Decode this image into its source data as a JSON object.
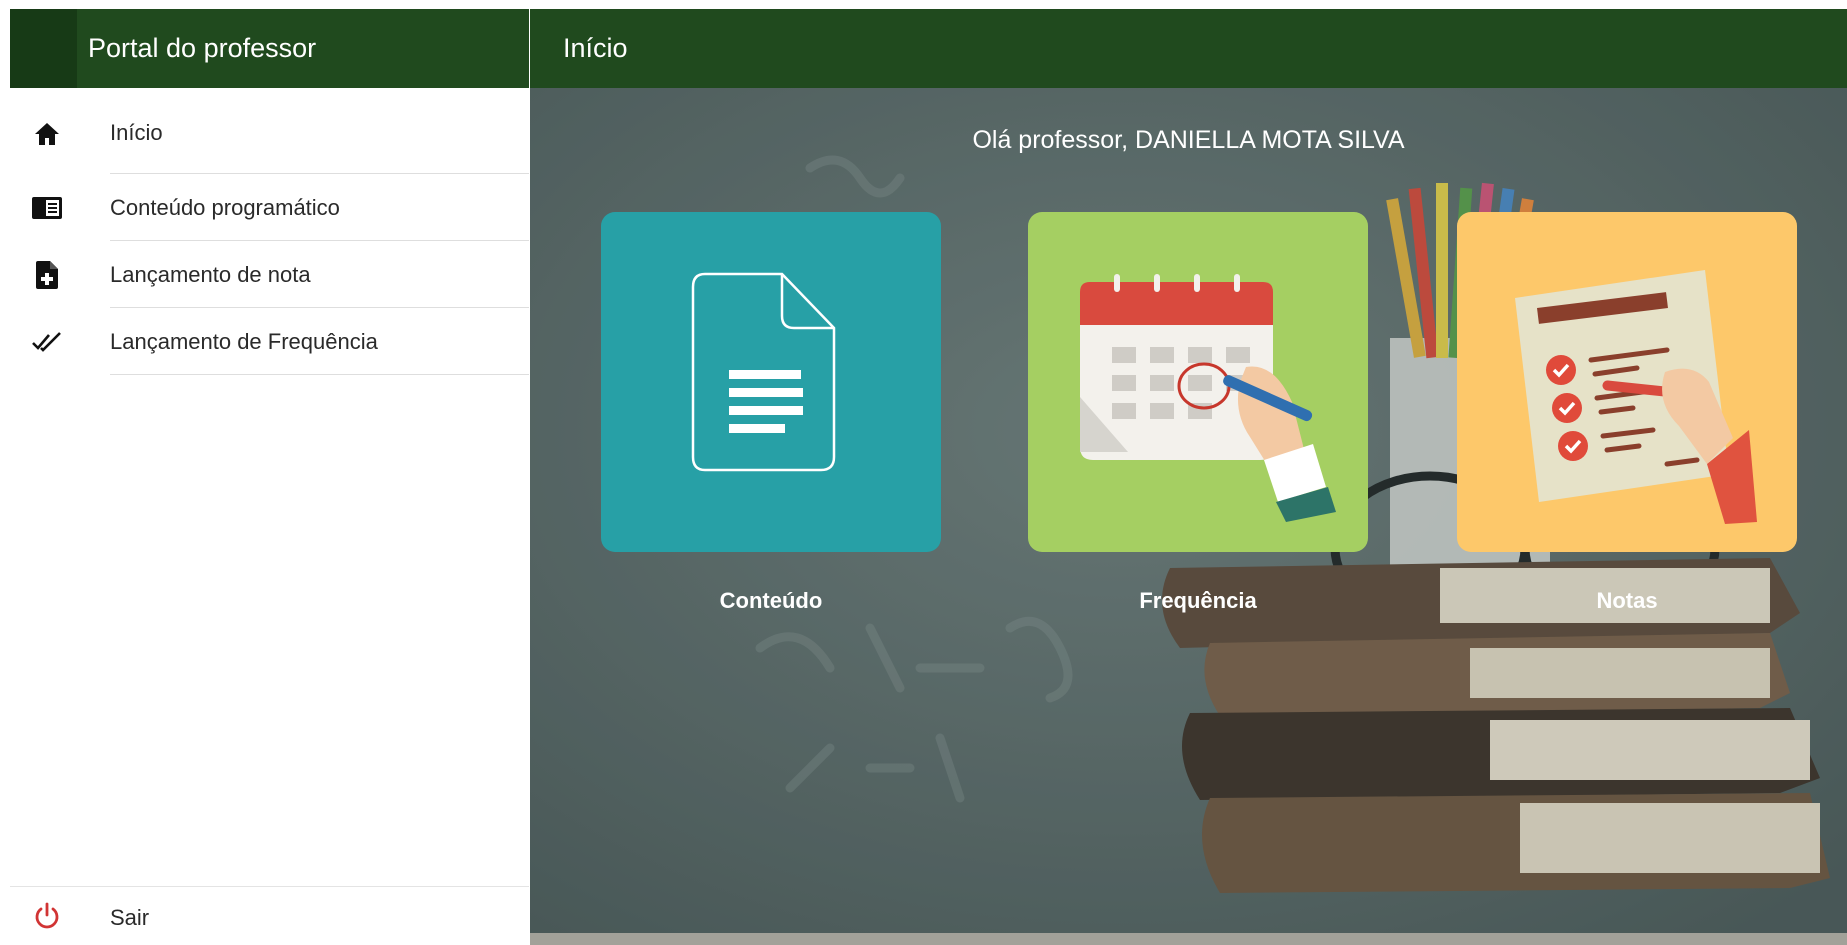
{
  "sidebar": {
    "title": "Portal do professor",
    "items": [
      {
        "label": "Início",
        "icon": "home-icon"
      },
      {
        "label": "Conteúdo programático",
        "icon": "book-icon"
      },
      {
        "label": "Lançamento de nota",
        "icon": "file-plus-icon"
      },
      {
        "label": "Lançamento de Frequência",
        "icon": "double-check-icon"
      }
    ],
    "logout": {
      "label": "Sair",
      "icon": "power-icon"
    }
  },
  "header": {
    "title": "Início"
  },
  "main": {
    "greeting": "Olá professor, DANIELLA MOTA SILVA",
    "cards": [
      {
        "label": "Conteúdo",
        "icon": "document-icon",
        "color": "#27a0a6"
      },
      {
        "label": "Frequência",
        "icon": "calendar-icon",
        "color": "#a5cf62"
      },
      {
        "label": "Notas",
        "icon": "checklist-icon",
        "color": "#fdc86a"
      }
    ]
  },
  "colors": {
    "header_green": "#204a1e",
    "logout_red": "#d13434"
  }
}
